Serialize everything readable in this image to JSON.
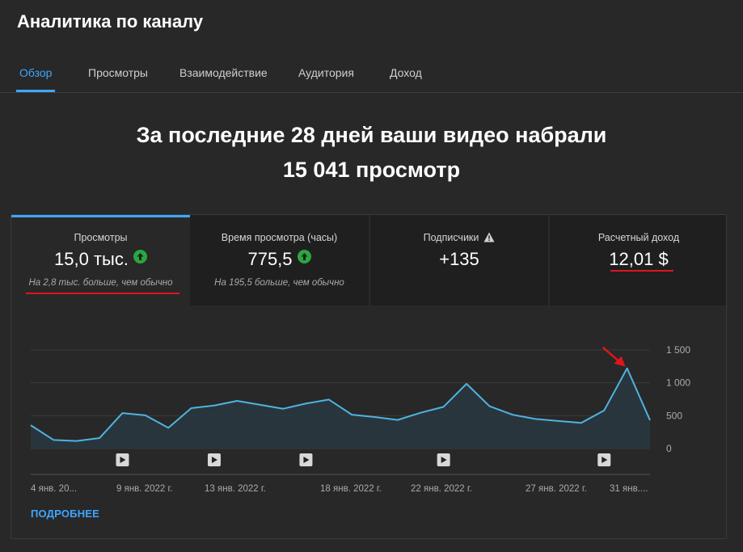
{
  "app": {
    "title": "Аналитика по каналу"
  },
  "tabs": [
    {
      "label": "Обзор",
      "active": true
    },
    {
      "label": "Просмотры",
      "active": false
    },
    {
      "label": "Взаимодействие",
      "active": false
    },
    {
      "label": "Аудитория",
      "active": false
    },
    {
      "label": "Доход",
      "active": false
    }
  ],
  "headline": {
    "line1": "За последние 28 дней ваши видео набрали",
    "line2": "15 041 просмотр"
  },
  "metrics": [
    {
      "label": "Просмотры",
      "value": "15,0 тыс.",
      "trend": "up",
      "note": "На 2,8 тыс. больше, чем обычно"
    },
    {
      "label": "Время просмотра (часы)",
      "value": "775,5",
      "trend": "up",
      "note": "На 195,5 больше, чем обычно"
    },
    {
      "label": "Подписчики",
      "value": "+135",
      "warning": true,
      "note": ""
    },
    {
      "label": "Расчетный доход",
      "value": "12,01 $",
      "note": ""
    }
  ],
  "colors": {
    "accent": "#3ea6ff",
    "trend_up": "#2ba640",
    "annotation_red": "#e0141e",
    "line": "#4fb3e0"
  },
  "chart_data": {
    "type": "area",
    "yticks": [
      "1 500",
      "1 000",
      "500",
      "0"
    ],
    "ylim": [
      0,
      1500
    ],
    "xticks": [
      "4 янв. 20...",
      "9 янв. 2022 г.",
      "13 янв. 2022 г.",
      "18 янв. 2022 г.",
      "22 янв. 2022 г.",
      "27 янв. 2022 г.",
      "31 янв...."
    ],
    "series": [
      {
        "values": [
          355,
          130,
          115,
          160,
          540,
          505,
          315,
          615,
          655,
          725,
          665,
          605,
          685,
          745,
          515,
          480,
          435,
          545,
          635,
          985,
          645,
          515,
          450,
          420,
          390,
          580,
          1220,
          430
        ]
      }
    ],
    "video_markers": [
      4,
      8,
      12,
      18,
      25
    ],
    "peak_arrow_index": 26,
    "grid": true
  },
  "footer": {
    "more_label": "ПОДРОБНЕЕ"
  }
}
